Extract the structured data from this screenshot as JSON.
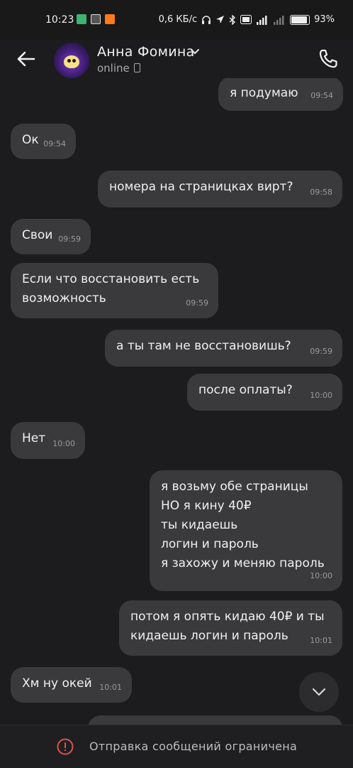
{
  "status_bar": {
    "time": "10:23",
    "speed": "0,6 КБ/с",
    "battery": "93",
    "battery_label": "93%"
  },
  "header": {
    "name": "Анна Фомина",
    "status": "online"
  },
  "messages": [
    {
      "side": "out",
      "text": "я подумаю",
      "time": "09:54"
    },
    {
      "side": "in",
      "text": "Ок",
      "time": "09:54"
    },
    {
      "side": "out",
      "text": "номера на страницках вирт?",
      "time": "09:58"
    },
    {
      "side": "in",
      "text": "Свои",
      "time": "09:59"
    },
    {
      "side": "in",
      "text": "Если что восстановить есть\nвозможность",
      "time": "09:59"
    },
    {
      "side": "out",
      "text": "а ты там не восстановишь?",
      "time": "09:59"
    },
    {
      "side": "out",
      "text": "после оплаты?",
      "time": "10:00"
    },
    {
      "side": "in",
      "text": "Нет",
      "time": "10:00"
    },
    {
      "side": "out",
      "text": "я возьму обе страницы\nНО я кину 40₽\nты кидаешь\nлогин и пароль\nя захожу и меняю пароль",
      "time": "10:00"
    },
    {
      "side": "out",
      "text": "потом я опять кидаю 40₽ и ты\nкидаешь логин и пароль",
      "time": "10:01"
    },
    {
      "side": "in",
      "text": "Хм ну окей",
      "time": "10:01"
    }
  ],
  "footer": {
    "notice": "Отправка сообщений ограничена"
  },
  "colors": {
    "background": "#1c1c1e",
    "bubble": "#3a3a3c",
    "warning": "#e0524f"
  }
}
